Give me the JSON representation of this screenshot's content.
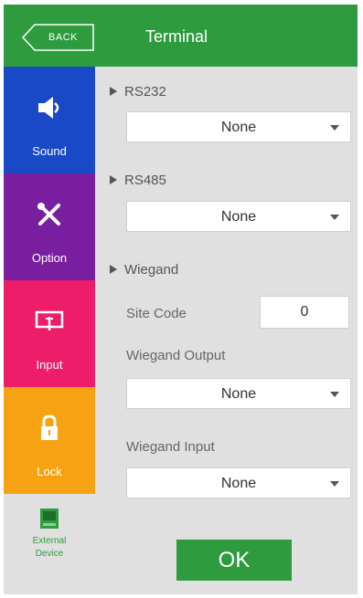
{
  "header": {
    "back_label": "BACK",
    "title": "Terminal"
  },
  "sidebar": {
    "items": [
      {
        "label": "Sound",
        "icon": "speaker-icon"
      },
      {
        "label": "Option",
        "icon": "tools-icon"
      },
      {
        "label": "Input",
        "icon": "input-icon"
      },
      {
        "label": "Lock",
        "icon": "lock-icon"
      },
      {
        "label_line1": "External",
        "label_line2": "Device",
        "icon": "external-device-icon"
      }
    ]
  },
  "main": {
    "rs232": {
      "label": "RS232",
      "value": "None"
    },
    "rs485": {
      "label": "RS485",
      "value": "None"
    },
    "wiegand": {
      "label": "Wiegand",
      "site_code_label": "Site Code",
      "site_code_value": "0",
      "output_label": "Wiegand Output",
      "output_value": "None",
      "input_label": "Wiegand Input",
      "input_value": "None"
    },
    "ok_label": "OK"
  },
  "colors": {
    "header": "#2e9b3f",
    "sound": "#1a49c8",
    "option": "#7a1ea0",
    "input": "#ee1d6a",
    "lock": "#f7a213",
    "content_bg": "#e0e0e0"
  }
}
